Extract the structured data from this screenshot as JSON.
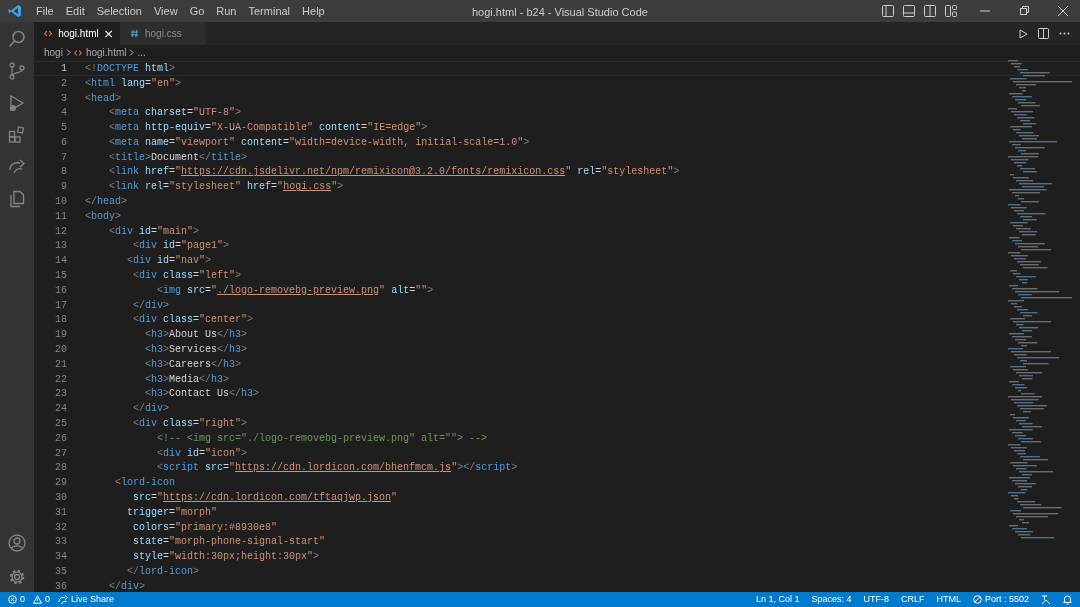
{
  "menu": [
    "File",
    "Edit",
    "Selection",
    "View",
    "Go",
    "Run",
    "Terminal",
    "Help"
  ],
  "window": {
    "title": "hogi.html - b24 - Visual Studio Code"
  },
  "tabs": [
    {
      "label": "hogi.html",
      "kind": "html",
      "selected": true
    },
    {
      "label": "hogi.css",
      "kind": "css",
      "selected": false
    }
  ],
  "breadcrumbs": [
    {
      "label": "hogi",
      "kind": "folder"
    },
    {
      "label": "hogi.html",
      "kind": "html"
    },
    {
      "label": "...",
      "kind": "more"
    }
  ],
  "lines": [
    {
      "number": "1",
      "current": true,
      "tokens": [
        {
          "kind": "punct",
          "text": "<!"
        },
        {
          "kind": "tag",
          "text": "DOCTYPE "
        },
        {
          "kind": "attr",
          "text": "html"
        },
        {
          "kind": "punct",
          "text": ">"
        }
      ]
    },
    {
      "number": "2",
      "current": false,
      "tokens": [
        {
          "kind": "punct",
          "text": "<"
        },
        {
          "kind": "tag",
          "text": "html "
        },
        {
          "kind": "attr",
          "text": "lang"
        },
        {
          "kind": "text",
          "text": "="
        },
        {
          "kind": "string",
          "text": "\"en\""
        },
        {
          "kind": "punct",
          "text": ">"
        }
      ]
    },
    {
      "number": "3",
      "current": false,
      "tokens": [
        {
          "kind": "punct",
          "text": "<"
        },
        {
          "kind": "tag",
          "text": "head"
        },
        {
          "kind": "punct",
          "text": ">"
        }
      ]
    },
    {
      "number": "4",
      "current": false,
      "tokens": [
        {
          "kind": "punct",
          "text": "    <"
        },
        {
          "kind": "tag",
          "text": "meta "
        },
        {
          "kind": "attr",
          "text": "charset"
        },
        {
          "kind": "text",
          "text": "="
        },
        {
          "kind": "string",
          "text": "\"UTF-8\""
        },
        {
          "kind": "punct",
          "text": ">"
        }
      ]
    },
    {
      "number": "5",
      "current": false,
      "tokens": [
        {
          "kind": "punct",
          "text": "    <"
        },
        {
          "kind": "tag",
          "text": "meta "
        },
        {
          "kind": "attr",
          "text": "http-equiv"
        },
        {
          "kind": "text",
          "text": "="
        },
        {
          "kind": "string",
          "text": "\"X-UA-Compatible\" "
        },
        {
          "kind": "attr",
          "text": "content"
        },
        {
          "kind": "text",
          "text": "="
        },
        {
          "kind": "string",
          "text": "\"IE=edge\""
        },
        {
          "kind": "punct",
          "text": ">"
        }
      ]
    },
    {
      "number": "6",
      "current": false,
      "tokens": [
        {
          "kind": "punct",
          "text": "    <"
        },
        {
          "kind": "tag",
          "text": "meta "
        },
        {
          "kind": "attr",
          "text": "name"
        },
        {
          "kind": "text",
          "text": "="
        },
        {
          "kind": "string",
          "text": "\"viewport\" "
        },
        {
          "kind": "attr",
          "text": "content"
        },
        {
          "kind": "text",
          "text": "="
        },
        {
          "kind": "string",
          "text": "\"width=device-width, initial-scale=1.0\""
        },
        {
          "kind": "punct",
          "text": ">"
        }
      ]
    },
    {
      "number": "7",
      "current": false,
      "tokens": [
        {
          "kind": "punct",
          "text": "    <"
        },
        {
          "kind": "tag",
          "text": "title"
        },
        {
          "kind": "punct",
          "text": ">"
        },
        {
          "kind": "text",
          "text": "Document"
        },
        {
          "kind": "punct",
          "text": "</"
        },
        {
          "kind": "tag",
          "text": "title"
        },
        {
          "kind": "punct",
          "text": ">"
        }
      ]
    },
    {
      "number": "8",
      "current": false,
      "tokens": [
        {
          "kind": "punct",
          "text": "    <"
        },
        {
          "kind": "tag",
          "text": "link "
        },
        {
          "kind": "attr",
          "text": "href"
        },
        {
          "kind": "text",
          "text": "="
        },
        {
          "kind": "string",
          "text": "\""
        },
        {
          "kind": "link",
          "text": "https://cdn.jsdelivr.net/npm/remixicon@3.2.0/fonts/remixicon.css"
        },
        {
          "kind": "string",
          "text": "\" "
        },
        {
          "kind": "attr",
          "text": "rel"
        },
        {
          "kind": "text",
          "text": "="
        },
        {
          "kind": "string",
          "text": "\"stylesheet\""
        },
        {
          "kind": "punct",
          "text": ">"
        }
      ]
    },
    {
      "number": "9",
      "current": false,
      "tokens": [
        {
          "kind": "punct",
          "text": "    <"
        },
        {
          "kind": "tag",
          "text": "link "
        },
        {
          "kind": "attr",
          "text": "rel"
        },
        {
          "kind": "text",
          "text": "="
        },
        {
          "kind": "string",
          "text": "\"stylesheet\" "
        },
        {
          "kind": "attr",
          "text": "href"
        },
        {
          "kind": "text",
          "text": "="
        },
        {
          "kind": "string",
          "text": "\""
        },
        {
          "kind": "link",
          "text": "hogi.css"
        },
        {
          "kind": "string",
          "text": "\""
        },
        {
          "kind": "punct",
          "text": ">"
        }
      ]
    },
    {
      "number": "10",
      "current": false,
      "tokens": [
        {
          "kind": "punct",
          "text": "</"
        },
        {
          "kind": "tag",
          "text": "head"
        },
        {
          "kind": "punct",
          "text": ">"
        }
      ]
    },
    {
      "number": "11",
      "current": false,
      "tokens": [
        {
          "kind": "punct",
          "text": "<"
        },
        {
          "kind": "tag",
          "text": "body"
        },
        {
          "kind": "punct",
          "text": ">"
        }
      ]
    },
    {
      "number": "12",
      "current": false,
      "tokens": [
        {
          "kind": "punct",
          "text": "    <"
        },
        {
          "kind": "tag",
          "text": "div "
        },
        {
          "kind": "attr",
          "text": "id"
        },
        {
          "kind": "text",
          "text": "="
        },
        {
          "kind": "string",
          "text": "\"main\""
        },
        {
          "kind": "punct",
          "text": ">"
        }
      ]
    },
    {
      "number": "13",
      "current": false,
      "tokens": [
        {
          "kind": "punct",
          "text": "        <"
        },
        {
          "kind": "tag",
          "text": "div "
        },
        {
          "kind": "attr",
          "text": "id"
        },
        {
          "kind": "text",
          "text": "="
        },
        {
          "kind": "string",
          "text": "\"page1\""
        },
        {
          "kind": "punct",
          "text": ">"
        }
      ]
    },
    {
      "number": "14",
      "current": false,
      "tokens": [
        {
          "kind": "punct",
          "text": "       <"
        },
        {
          "kind": "tag",
          "text": "div "
        },
        {
          "kind": "attr",
          "text": "id"
        },
        {
          "kind": "text",
          "text": "="
        },
        {
          "kind": "string",
          "text": "\"nav\""
        },
        {
          "kind": "punct",
          "text": ">"
        }
      ]
    },
    {
      "number": "15",
      "current": false,
      "tokens": [
        {
          "kind": "punct",
          "text": "        <"
        },
        {
          "kind": "tag",
          "text": "div "
        },
        {
          "kind": "attr",
          "text": "class"
        },
        {
          "kind": "text",
          "text": "="
        },
        {
          "kind": "string",
          "text": "\"left\""
        },
        {
          "kind": "punct",
          "text": ">"
        }
      ]
    },
    {
      "number": "16",
      "current": false,
      "tokens": [
        {
          "kind": "punct",
          "text": "            <"
        },
        {
          "kind": "tag",
          "text": "img "
        },
        {
          "kind": "attr",
          "text": "src"
        },
        {
          "kind": "text",
          "text": "="
        },
        {
          "kind": "string",
          "text": "\""
        },
        {
          "kind": "link",
          "text": "./logo-removebg-preview.png"
        },
        {
          "kind": "string",
          "text": "\" "
        },
        {
          "kind": "attr",
          "text": "alt"
        },
        {
          "kind": "text",
          "text": "="
        },
        {
          "kind": "string",
          "text": "\"\""
        },
        {
          "kind": "punct",
          "text": ">"
        }
      ]
    },
    {
      "number": "17",
      "current": false,
      "tokens": [
        {
          "kind": "punct",
          "text": "        </"
        },
        {
          "kind": "tag",
          "text": "div"
        },
        {
          "kind": "punct",
          "text": ">"
        }
      ]
    },
    {
      "number": "18",
      "current": false,
      "tokens": [
        {
          "kind": "punct",
          "text": "        <"
        },
        {
          "kind": "tag",
          "text": "div "
        },
        {
          "kind": "attr",
          "text": "class"
        },
        {
          "kind": "text",
          "text": "="
        },
        {
          "kind": "string",
          "text": "\"center\""
        },
        {
          "kind": "punct",
          "text": ">"
        }
      ]
    },
    {
      "number": "19",
      "current": false,
      "tokens": [
        {
          "kind": "punct",
          "text": "          <"
        },
        {
          "kind": "tag",
          "text": "h3"
        },
        {
          "kind": "punct",
          "text": ">"
        },
        {
          "kind": "text",
          "text": "About Us"
        },
        {
          "kind": "punct",
          "text": "</"
        },
        {
          "kind": "tag",
          "text": "h3"
        },
        {
          "kind": "punct",
          "text": ">"
        }
      ]
    },
    {
      "number": "20",
      "current": false,
      "tokens": [
        {
          "kind": "punct",
          "text": "          <"
        },
        {
          "kind": "tag",
          "text": "h3"
        },
        {
          "kind": "punct",
          "text": ">"
        },
        {
          "kind": "text",
          "text": "Services"
        },
        {
          "kind": "punct",
          "text": "</"
        },
        {
          "kind": "tag",
          "text": "h3"
        },
        {
          "kind": "punct",
          "text": ">"
        }
      ]
    },
    {
      "number": "21",
      "current": false,
      "tokens": [
        {
          "kind": "punct",
          "text": "          <"
        },
        {
          "kind": "tag",
          "text": "h3"
        },
        {
          "kind": "punct",
          "text": ">"
        },
        {
          "kind": "text",
          "text": "Careers"
        },
        {
          "kind": "punct",
          "text": "</"
        },
        {
          "kind": "tag",
          "text": "h3"
        },
        {
          "kind": "punct",
          "text": ">"
        }
      ]
    },
    {
      "number": "22",
      "current": false,
      "tokens": [
        {
          "kind": "punct",
          "text": "          <"
        },
        {
          "kind": "tag",
          "text": "h3"
        },
        {
          "kind": "punct",
          "text": ">"
        },
        {
          "kind": "text",
          "text": "Media"
        },
        {
          "kind": "punct",
          "text": "</"
        },
        {
          "kind": "tag",
          "text": "h3"
        },
        {
          "kind": "punct",
          "text": ">"
        }
      ]
    },
    {
      "number": "23",
      "current": false,
      "tokens": [
        {
          "kind": "punct",
          "text": "          <"
        },
        {
          "kind": "tag",
          "text": "h3"
        },
        {
          "kind": "punct",
          "text": ">"
        },
        {
          "kind": "text",
          "text": "Contact Us"
        },
        {
          "kind": "punct",
          "text": "</"
        },
        {
          "kind": "tag",
          "text": "h3"
        },
        {
          "kind": "punct",
          "text": ">"
        }
      ]
    },
    {
      "number": "24",
      "current": false,
      "tokens": [
        {
          "kind": "punct",
          "text": "        </"
        },
        {
          "kind": "tag",
          "text": "div"
        },
        {
          "kind": "punct",
          "text": ">"
        }
      ]
    },
    {
      "number": "25",
      "current": false,
      "tokens": [
        {
          "kind": "punct",
          "text": "        <"
        },
        {
          "kind": "tag",
          "text": "div "
        },
        {
          "kind": "attr",
          "text": "class"
        },
        {
          "kind": "text",
          "text": "="
        },
        {
          "kind": "string",
          "text": "\"right\""
        },
        {
          "kind": "punct",
          "text": ">"
        }
      ]
    },
    {
      "number": "26",
      "current": false,
      "tokens": [
        {
          "kind": "comment",
          "text": "            <!-- <img src=\"./logo-removebg-preview.png\" alt=\"\"> -->"
        }
      ]
    },
    {
      "number": "27",
      "current": false,
      "tokens": [
        {
          "kind": "punct",
          "text": "            <"
        },
        {
          "kind": "tag",
          "text": "div "
        },
        {
          "kind": "attr",
          "text": "id"
        },
        {
          "kind": "text",
          "text": "="
        },
        {
          "kind": "string",
          "text": "\"icon\""
        },
        {
          "kind": "punct",
          "text": ">"
        }
      ]
    },
    {
      "number": "28",
      "current": false,
      "tokens": [
        {
          "kind": "punct",
          "text": "            <"
        },
        {
          "kind": "tag",
          "text": "script "
        },
        {
          "kind": "attr",
          "text": "src"
        },
        {
          "kind": "text",
          "text": "="
        },
        {
          "kind": "string",
          "text": "\""
        },
        {
          "kind": "link",
          "text": "https://cdn.lordicon.com/bhenfmcm.js"
        },
        {
          "kind": "string",
          "text": "\""
        },
        {
          "kind": "punct",
          "text": "></"
        },
        {
          "kind": "tag",
          "text": "script"
        },
        {
          "kind": "punct",
          "text": ">"
        }
      ]
    },
    {
      "number": "29",
      "current": false,
      "tokens": [
        {
          "kind": "punct",
          "text": "     <"
        },
        {
          "kind": "tag",
          "text": "lord-icon"
        }
      ]
    },
    {
      "number": "30",
      "current": false,
      "tokens": [
        {
          "kind": "attr",
          "text": "        src"
        },
        {
          "kind": "text",
          "text": "="
        },
        {
          "kind": "string",
          "text": "\""
        },
        {
          "kind": "link",
          "text": "https://cdn.lordicon.com/tftaqjwp.json"
        },
        {
          "kind": "string",
          "text": "\""
        }
      ]
    },
    {
      "number": "31",
      "current": false,
      "tokens": [
        {
          "kind": "attr",
          "text": "       trigger"
        },
        {
          "kind": "text",
          "text": "="
        },
        {
          "kind": "string",
          "text": "\"morph\""
        }
      ]
    },
    {
      "number": "32",
      "current": false,
      "tokens": [
        {
          "kind": "attr",
          "text": "        colors"
        },
        {
          "kind": "text",
          "text": "="
        },
        {
          "kind": "string",
          "text": "\"primary:#8930e8\""
        }
      ]
    },
    {
      "number": "33",
      "current": false,
      "tokens": [
        {
          "kind": "attr",
          "text": "        state"
        },
        {
          "kind": "text",
          "text": "="
        },
        {
          "kind": "string",
          "text": "\"morph-phone-signal-start\""
        }
      ]
    },
    {
      "number": "34",
      "current": false,
      "tokens": [
        {
          "kind": "attr",
          "text": "        style"
        },
        {
          "kind": "text",
          "text": "="
        },
        {
          "kind": "string",
          "text": "\"width:30px;height:30px\""
        },
        {
          "kind": "punct",
          "text": ">"
        }
      ]
    },
    {
      "number": "35",
      "current": false,
      "tokens": [
        {
          "kind": "punct",
          "text": "       </"
        },
        {
          "kind": "tag",
          "text": "lord-icon"
        },
        {
          "kind": "punct",
          "text": ">"
        }
      ]
    },
    {
      "number": "36",
      "current": false,
      "tokens": [
        {
          "kind": "punct",
          "text": "    </"
        },
        {
          "kind": "tag",
          "text": "div"
        },
        {
          "kind": "punct",
          "text": ">"
        }
      ]
    }
  ],
  "status_bar": {
    "left": [
      {
        "kind": "errors",
        "text": "0"
      },
      {
        "kind": "warnings",
        "text": "0"
      },
      {
        "kind": "liveshare",
        "text": "Live Share"
      }
    ],
    "right": [
      {
        "kind": "plain",
        "text": "Ln 1, Col 1"
      },
      {
        "kind": "plain",
        "text": "Spaces: 4"
      },
      {
        "kind": "plain",
        "text": "UTF-8"
      },
      {
        "kind": "plain",
        "text": "CRLF"
      },
      {
        "kind": "plain",
        "text": "HTML"
      },
      {
        "kind": "port",
        "text": "Port : 5502"
      }
    ]
  }
}
